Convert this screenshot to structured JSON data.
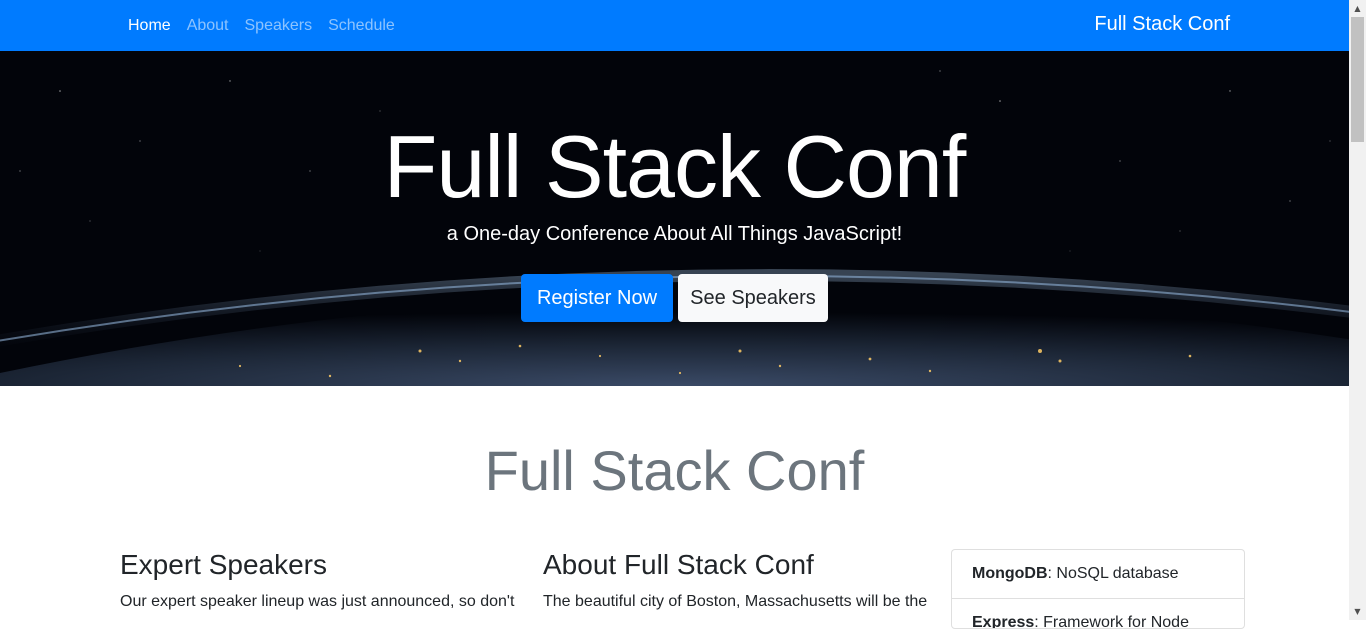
{
  "nav": {
    "links": [
      "Home",
      "About",
      "Speakers",
      "Schedule"
    ],
    "active_link": "Home",
    "brand": "Full Stack Conf"
  },
  "hero": {
    "title": "Full Stack Conf",
    "subtitle": "a One-day Conference About All Things JavaScript!",
    "primary_button": "Register Now",
    "secondary_button": "See Speakers"
  },
  "main": {
    "title": "Full Stack Conf",
    "columns": [
      {
        "title": "Expert Speakers",
        "text": "Our expert speaker lineup was just announced, so don't"
      },
      {
        "title": "About Full Stack Conf",
        "text": "The beautiful city of Boston, Massachusetts will be the"
      }
    ],
    "tech_list": [
      {
        "name": "MongoDB",
        "desc": ": NoSQL database"
      },
      {
        "name": "Express",
        "desc": ": Framework for Node"
      }
    ]
  },
  "colors": {
    "primary": "#007bff",
    "light": "#f8f9fa",
    "muted": "#6c757d"
  },
  "icons": {
    "scroll_up": "arrow-up-icon",
    "scroll_down": "arrow-down-icon"
  }
}
